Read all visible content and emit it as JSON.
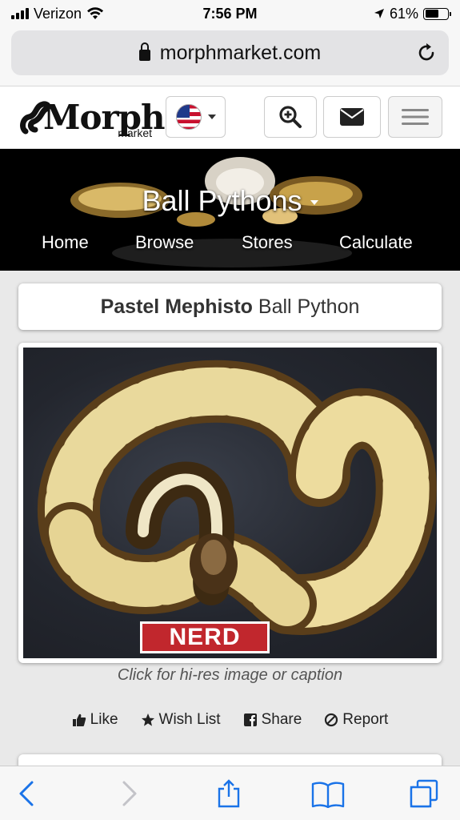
{
  "status_bar": {
    "carrier": "Verizon",
    "time": "7:56 PM",
    "battery": "61%",
    "battery_level": 0.61
  },
  "browser": {
    "url": "morphmarket.com"
  },
  "site": {
    "logo_main": "Morph",
    "logo_sub": "market",
    "country_icon": "us-flag-icon"
  },
  "hero": {
    "category": "Ball Pythons",
    "nav": [
      "Home",
      "Browse",
      "Stores",
      "Calculate"
    ]
  },
  "listing": {
    "morph": "Pastel Mephisto",
    "species": "Ball Python",
    "watermark": "NERD",
    "caption": "Click for hi-res image or caption"
  },
  "actions": [
    {
      "label": "Like",
      "icon": "thumbs-up-icon"
    },
    {
      "label": "Wish List",
      "icon": "star-icon"
    },
    {
      "label": "Share",
      "icon": "facebook-icon"
    },
    {
      "label": "Report",
      "icon": "ban-icon"
    }
  ],
  "colors": {
    "accent_blue": "#1a73e8",
    "nerd_red": "#c1272d"
  }
}
